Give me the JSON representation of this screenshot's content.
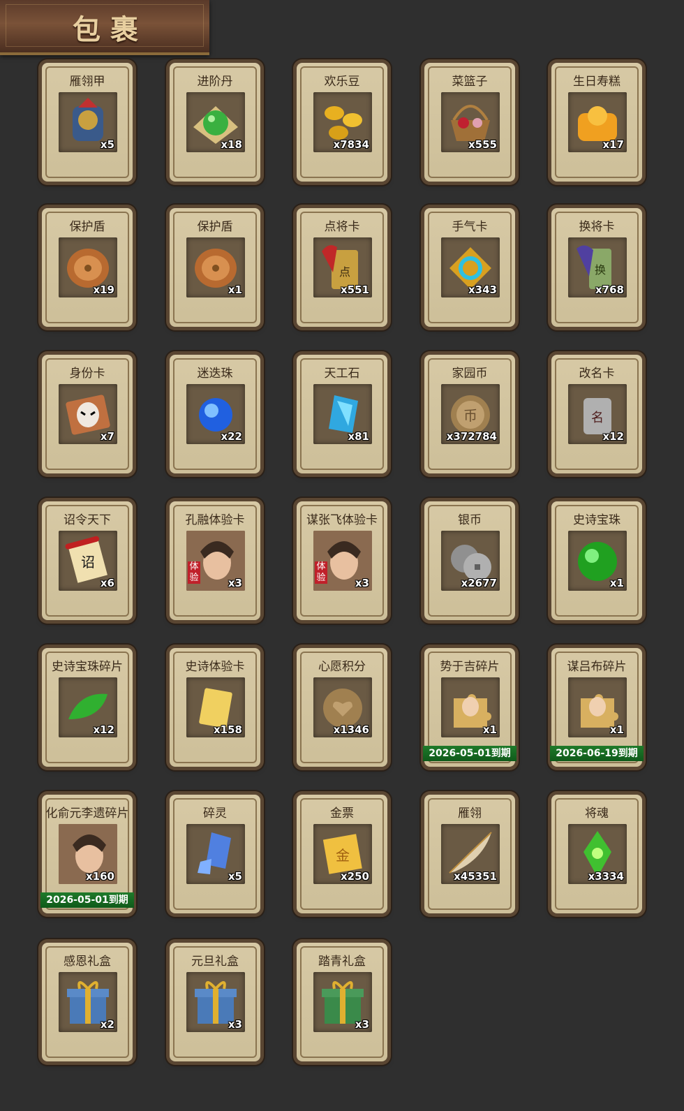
{
  "header": {
    "title": "包裹"
  },
  "items": [
    {
      "name": "雁翎甲",
      "count": "x5",
      "icon": "armor-icon",
      "expiry": ""
    },
    {
      "name": "进阶丹",
      "count": "x18",
      "icon": "green-pill-icon",
      "expiry": ""
    },
    {
      "name": "欢乐豆",
      "count": "x7834",
      "icon": "gold-beans-icon",
      "expiry": ""
    },
    {
      "name": "菜篮子",
      "count": "x555",
      "icon": "basket-icon",
      "expiry": ""
    },
    {
      "name": "生日寿糕",
      "count": "x17",
      "icon": "birthday-cake-icon",
      "expiry": ""
    },
    {
      "name": "保护盾",
      "count": "x19",
      "icon": "shield-icon",
      "expiry": ""
    },
    {
      "name": "保护盾",
      "count": "x1",
      "icon": "shield-icon",
      "expiry": ""
    },
    {
      "name": "点将卡",
      "count": "x551",
      "icon": "general-card-icon",
      "expiry": ""
    },
    {
      "name": "手气卡",
      "count": "x343",
      "icon": "luck-card-icon",
      "expiry": ""
    },
    {
      "name": "换将卡",
      "count": "x768",
      "icon": "swap-card-icon",
      "expiry": ""
    },
    {
      "name": "身份卡",
      "count": "x7",
      "icon": "identity-card-icon",
      "expiry": ""
    },
    {
      "name": "迷迭珠",
      "count": "x22",
      "icon": "blue-orb-icon",
      "expiry": ""
    },
    {
      "name": "天工石",
      "count": "x81",
      "icon": "crystal-icon",
      "expiry": ""
    },
    {
      "name": "家园币",
      "count": "x372784",
      "icon": "coin-icon",
      "expiry": ""
    },
    {
      "name": "改名卡",
      "count": "x12",
      "icon": "rename-card-icon",
      "expiry": ""
    },
    {
      "name": "诏令天下",
      "count": "x6",
      "icon": "scroll-icon",
      "expiry": ""
    },
    {
      "name": "孔融体验卡",
      "count": "x3",
      "icon": "portrait-icon",
      "expiry": "",
      "badge": "体验"
    },
    {
      "name": "谋张飞体验卡",
      "count": "x3",
      "icon": "portrait-icon",
      "expiry": "",
      "badge": "体验"
    },
    {
      "name": "银币",
      "count": "x2677",
      "icon": "silver-coin-icon",
      "expiry": ""
    },
    {
      "name": "史诗宝珠",
      "count": "x1",
      "icon": "green-orb-icon",
      "expiry": ""
    },
    {
      "name": "史诗宝珠碎片",
      "count": "x12",
      "icon": "green-shard-icon",
      "expiry": ""
    },
    {
      "name": "史诗体验卡",
      "count": "x158",
      "icon": "gold-card-icon",
      "expiry": ""
    },
    {
      "name": "心愿积分",
      "count": "x1346",
      "icon": "heart-coin-icon",
      "expiry": ""
    },
    {
      "name": "势于吉碎片",
      "count": "x1",
      "icon": "puzzle-icon",
      "expiry": "2026-05-01到期"
    },
    {
      "name": "谋吕布碎片",
      "count": "x1",
      "icon": "puzzle-icon",
      "expiry": "2026-06-19到期"
    },
    {
      "name": "化俞元李遗碎片",
      "count": "x160",
      "icon": "portrait-icon",
      "expiry": "2026-05-01到期"
    },
    {
      "name": "碎灵",
      "count": "x5",
      "icon": "blue-crystal-icon",
      "expiry": ""
    },
    {
      "name": "金票",
      "count": "x250",
      "icon": "gold-ticket-icon",
      "expiry": ""
    },
    {
      "name": "雁翎",
      "count": "x45351",
      "icon": "feather-icon",
      "expiry": ""
    },
    {
      "name": "将魂",
      "count": "x3334",
      "icon": "green-soul-icon",
      "expiry": ""
    },
    {
      "name": "感恩礼盒",
      "count": "x2",
      "icon": "gift-box-icon",
      "expiry": ""
    },
    {
      "name": "元旦礼盒",
      "count": "x3",
      "icon": "gift-box-icon",
      "expiry": ""
    },
    {
      "name": "踏青礼盒",
      "count": "x3",
      "icon": "green-gift-box-icon",
      "expiry": ""
    }
  ]
}
